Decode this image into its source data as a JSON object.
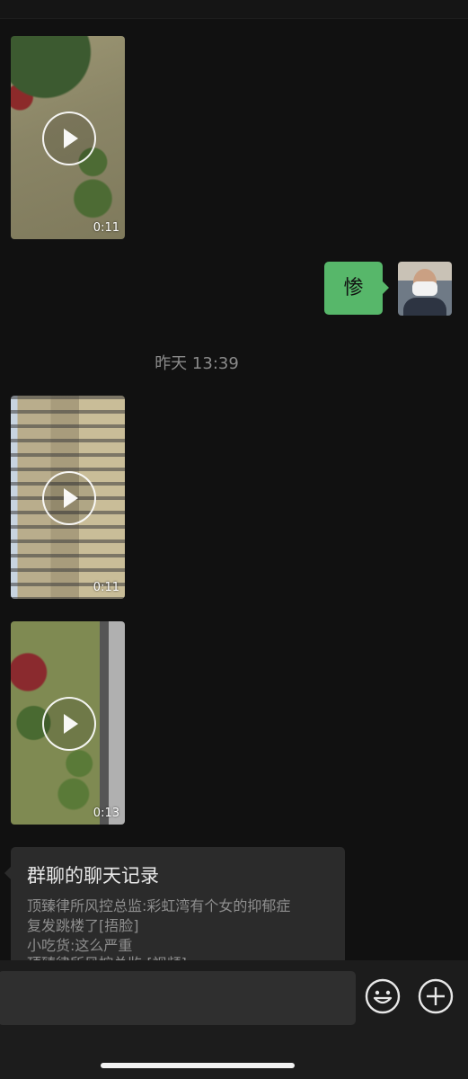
{
  "chat": {
    "videos": [
      {
        "duration": "0:11"
      },
      {
        "duration": "0:11"
      },
      {
        "duration": "0:13"
      }
    ],
    "sent_message": {
      "text": "惨"
    },
    "timestamp": "昨天 13:39",
    "chat_record": {
      "title": "群聊的聊天记录",
      "lines": [
        "顶臻律所风控总监:彩虹湾有个女的抑郁症",
        "复发跳楼了[捂脸]",
        "小吃货:这么严重",
        "顶臻律所风控总监:[视频]"
      ]
    }
  },
  "input_bar": {
    "value": "",
    "icons": [
      "smiley-icon",
      "plus-icon"
    ]
  },
  "colors": {
    "background": "#111111",
    "sent_bubble": "#57b76a",
    "card": "#2b2b2b"
  }
}
